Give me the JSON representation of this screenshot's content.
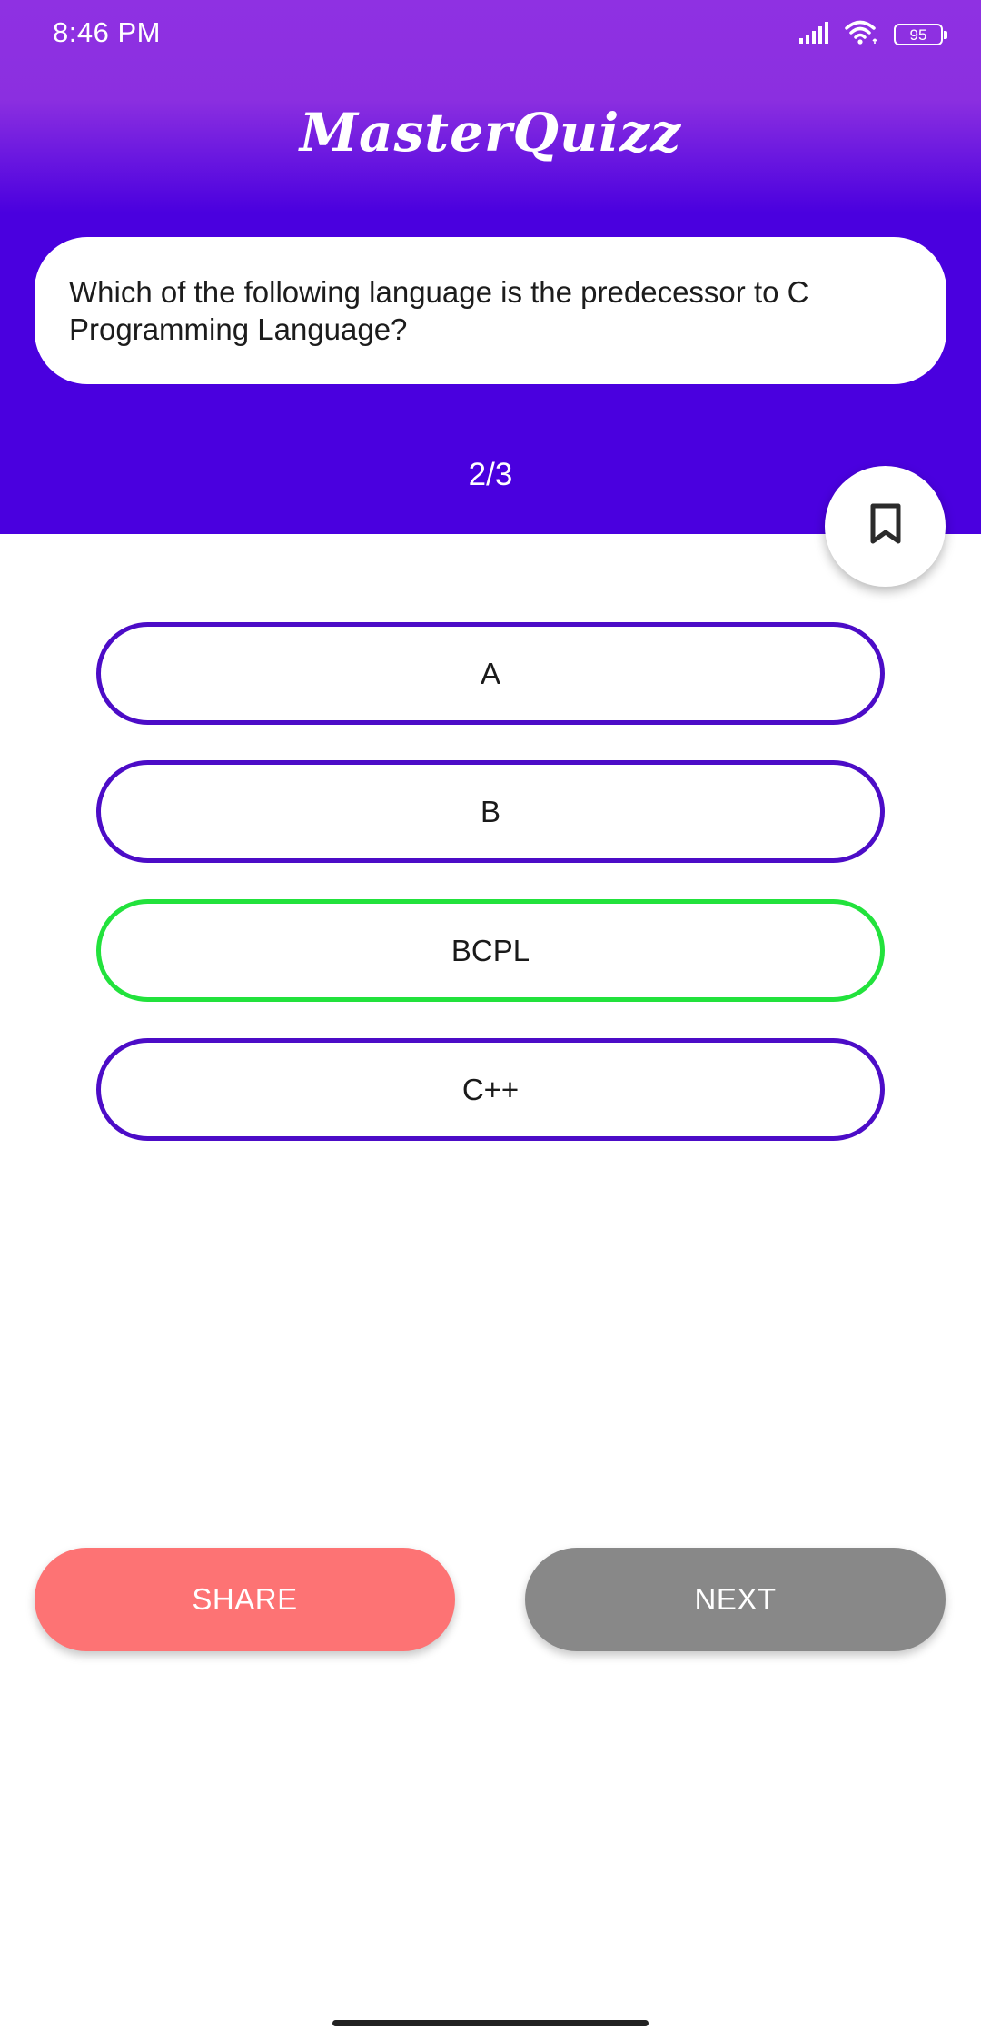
{
  "status_bar": {
    "time": "8:46 PM",
    "battery_level": "95",
    "icons": [
      "signal-icon",
      "wifi-icon",
      "battery-icon"
    ]
  },
  "app": {
    "title": "MasterQuizz"
  },
  "question": {
    "text": "Which of the following language is the predecessor to C Programming Language?",
    "progress": "2/3"
  },
  "bookmark": {
    "icon": "bookmark-icon"
  },
  "options": [
    {
      "label": "A",
      "state": "default"
    },
    {
      "label": "B",
      "state": "default"
    },
    {
      "label": "BCPL",
      "state": "correct"
    },
    {
      "label": "C++",
      "state": "default"
    }
  ],
  "actions": {
    "share_label": "SHARE",
    "next_label": "NEXT"
  },
  "colors": {
    "header_top": "#8f31e2",
    "header_bottom": "#4a00df",
    "option_border": "#4c0cc7",
    "option_correct_border": "#22e23c",
    "share_button": "#fd7374",
    "next_button": "#888888"
  }
}
